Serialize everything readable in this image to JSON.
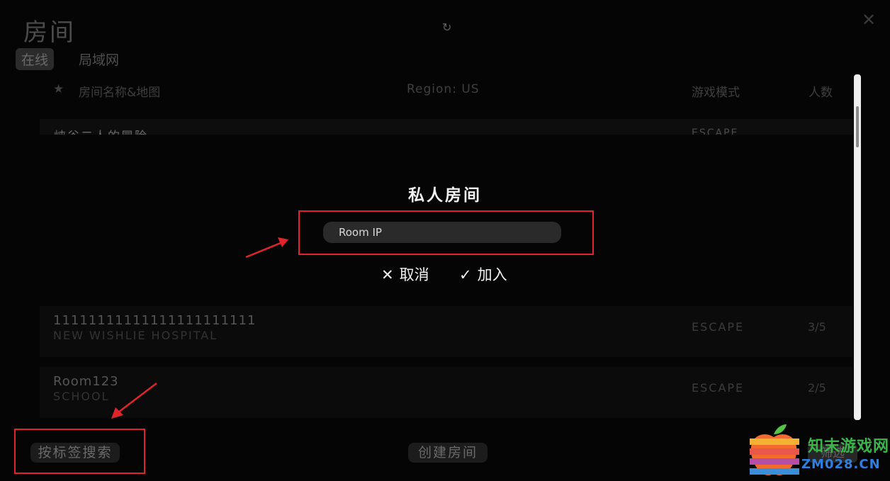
{
  "header": {
    "title": "房间",
    "refresh_icon": "↻",
    "close_icon": "✕"
  },
  "tabs": [
    {
      "label": "在线",
      "active": true
    },
    {
      "label": "局域网",
      "active": false
    }
  ],
  "columns": {
    "star_icon": "★",
    "name": "房间名称&地图",
    "region": "Region: US",
    "mode": "游戏模式",
    "players": "人数"
  },
  "rows": [
    {
      "name": "11111111111111111111111",
      "map": "NEW WISHLIE HOSPITAL",
      "mode": "ESCAPE",
      "players": "3/5"
    },
    {
      "name": "Room123",
      "map": "SCHOOL",
      "mode": "ESCAPE",
      "players": "2/5"
    }
  ],
  "partial_row": {
    "name": "峡谷二人的冒险"
  },
  "modal": {
    "title": "私人房间",
    "input_placeholder": "Room IP",
    "cancel_icon": "✕",
    "cancel_label": "取消",
    "join_icon": "✓",
    "join_label": "加入"
  },
  "footer": {
    "search_by_tag": "按标签搜索",
    "create_room": "创建房间",
    "filter": "筛选"
  },
  "watermark": {
    "name": "知末游戏网",
    "domain": "ZM028.CN"
  },
  "colors": {
    "annotation_red": "#e0242b",
    "background": "#050505",
    "watermark_green": "#3bb54a",
    "watermark_blue": "#2f7fe0"
  },
  "icons": [
    "refresh-icon",
    "close-icon",
    "star-icon",
    "x-icon",
    "check-icon",
    "apple-logo-icon"
  ]
}
